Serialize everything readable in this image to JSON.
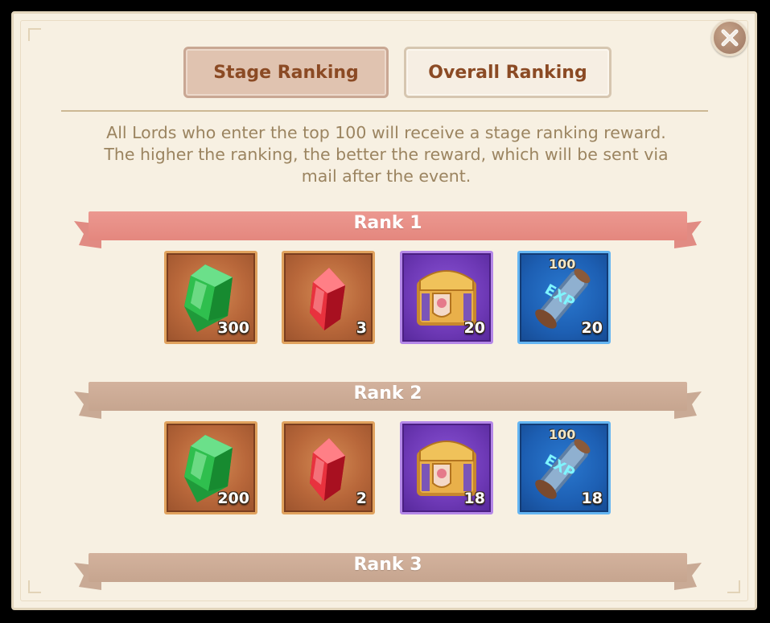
{
  "dialog": {
    "close_label": "✕"
  },
  "tabs": [
    {
      "label": "Stage Ranking",
      "active": true
    },
    {
      "label": "Overall Ranking",
      "active": false
    }
  ],
  "description": "All Lords who enter the top 100 will receive a stage ranking reward. The higher the ranking, the better the reward, which will be sent via mail after the event.",
  "colors": {
    "rank1_ribbon": "#e4877e",
    "rank_other_ribbon": "#c6a58f",
    "tab_text": "#8b4a24",
    "description_text": "#9b8460"
  },
  "ranks": [
    {
      "label": "Rank 1",
      "rewards": [
        {
          "icon": "green-gem-icon",
          "quantity": "300"
        },
        {
          "icon": "red-gem-icon",
          "quantity": "3"
        },
        {
          "icon": "treasure-chest-icon",
          "quantity": "20"
        },
        {
          "icon": "exp-scroll-icon",
          "top_label": "100",
          "quantity": "20"
        }
      ]
    },
    {
      "label": "Rank 2",
      "rewards": [
        {
          "icon": "green-gem-icon",
          "quantity": "200"
        },
        {
          "icon": "red-gem-icon",
          "quantity": "2"
        },
        {
          "icon": "treasure-chest-icon",
          "quantity": "18"
        },
        {
          "icon": "exp-scroll-icon",
          "top_label": "100",
          "quantity": "18"
        }
      ]
    },
    {
      "label": "Rank 3"
    }
  ]
}
